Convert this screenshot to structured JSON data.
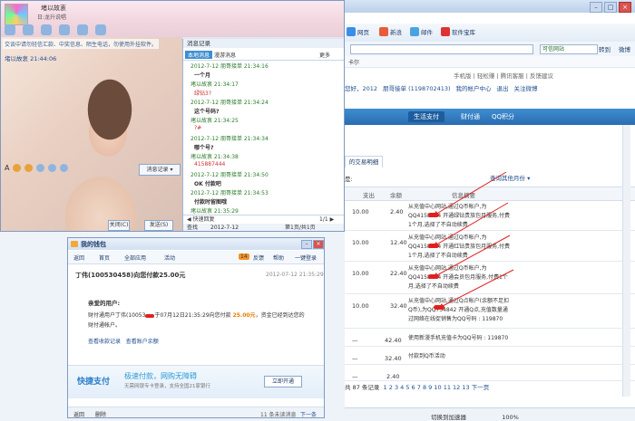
{
  "browser": {
    "toolbar": {
      "web": "网页",
      "social": "新浪",
      "mail": "邮件",
      "software": "软件宝库"
    },
    "address": {
      "safe_site": "可信网站",
      "go": "转到",
      "extra": "微博"
    },
    "bookmark_bar": "卡尔",
    "top_links": "手机版 | 轻松赚 | 腾讯客服 | 反馈建议",
    "user_line": {
      "prefix": "您好，2012",
      "account": "朋哥接单 (1198702413)",
      "my_center": "我的帐户中心",
      "logout": "退出",
      "follow": "关注微博"
    },
    "tabs": [
      "生活支付",
      "财付通",
      "QQ积分"
    ],
    "trade_tab": "的交易明细",
    "range_label": "是:",
    "query_other": "查询其他月份 ▾",
    "table_headers": {
      "out": "支出",
      "balance": "余额",
      "info": "信息摘要"
    },
    "rows": [
      {
        "out": "10.00",
        "balance": "2.40",
        "desc": "从充值中心网站,通过Q币帐户,为QQ4158874 开通绿钻贵族包月服务,付费1个月,选择了不自动续费"
      },
      {
        "out": "10.00",
        "balance": "12.40",
        "desc": "从充值中心网站,通过Q币帐户,为QQ4158874 开通红钻贵族包月服务,付费1个月,选择了不自动续费"
      },
      {
        "out": "10.00",
        "balance": "22.40",
        "desc": "从充值中心网站,通过Q币帐户,为QQ4158874 开通会员包月服务,付费1个月,选择了不自动续费"
      },
      {
        "out": "10.00",
        "balance": "32.40",
        "desc": "从充值中心网站,通过Q点帐户(余额不足扣Q币),为QQ734842 开通Q点,充值数量通过网络在线促销售为QQ号码 : 119870"
      }
    ],
    "extra_rows": [
      {
        "dash": "—",
        "balance": "42.40",
        "text": "使用新漫手机充值卡为QQ号码 : 119870"
      },
      {
        "dash": "—",
        "balance": "32.40",
        "text": "付款到Q币活动"
      },
      {
        "dash": "—",
        "balance": "2.40",
        "text": ""
      }
    ],
    "pager": {
      "total": "共 87 条记录",
      "pages": "1 2 3 4 5 6 7 8 9 10 11 12 13",
      "next": "下一页"
    },
    "status": {
      "speed": "切换到加速器",
      "zoom": "100%"
    }
  },
  "qq": {
    "name": "堵以故衷",
    "status": "日:龙升说唱",
    "warning": "交谈中请勿轻信汇款、中奖信息、陌生电话，勿使用外挂软件。",
    "chat_name": "堵以故衷   21:44:06",
    "msg_record_btn": "消息记录 ▾",
    "close_btn": "关闭(C)",
    "send_btn": "发送(S)",
    "history": {
      "title": "消息记录",
      "tab1": "本地消息",
      "tab2": "漫游消息",
      "more": "更多",
      "lines": [
        {
          "meta": "2012-7-12  朋哥接单 21:34:16",
          "msg": ""
        },
        {
          "meta": "",
          "msg": "一个月"
        },
        {
          "meta": "堵以故衷  21:34:17",
          "msg": ""
        },
        {
          "meta": "",
          "msg": "绿钻3?",
          "red": true
        },
        {
          "meta": "2012-7-12  朋哥接单 21:34:24",
          "msg": ""
        },
        {
          "meta": "",
          "msg": "这个号码?"
        },
        {
          "meta": "堵以故衷  21:34:25",
          "msg": ""
        },
        {
          "meta": "",
          "msg": "?#",
          "red": true
        },
        {
          "meta": "2012-7-12  朋哥接单 21:34:34",
          "msg": ""
        },
        {
          "meta": "",
          "msg": "哪个号?"
        },
        {
          "meta": "堵以故衷  21:34:38",
          "msg": ""
        },
        {
          "meta": "",
          "msg": "415887444",
          "red": true
        },
        {
          "meta": "2012-7-12  朋哥接单 21:34:50",
          "msg": ""
        },
        {
          "meta": "",
          "msg": "OK 付款吧"
        },
        {
          "meta": "2012-7-12  朋哥接单 21:34:53",
          "msg": ""
        },
        {
          "meta": "",
          "msg": "付款时留图哦"
        },
        {
          "meta": "堵以故衷  21:35:29",
          "msg": ""
        }
      ],
      "footer_left": "◀ 快速回复",
      "footer_right": "1/1 ▶",
      "search": "查找",
      "date": "2012-7-12",
      "page": "第1页/共1页"
    }
  },
  "wallet": {
    "title": "我的钱包",
    "toolbar": [
      "返回",
      "首页",
      "全部应用",
      "活动",
      "14",
      "反馈",
      "帮助",
      "一键登录"
    ],
    "subject": "丁伟(100530458)向您付款25.00元",
    "time": "2012-07-12 21:35:29",
    "greet": "亲爱的用户:",
    "body_prefix": "财付通用户丁伟(10053",
    "body_mid": "于07月12日21:35:29向您付款",
    "amount": "25.00元",
    "body_suffix": "，资金已经到达您的财付通帐户。",
    "link1": "查看收款记录",
    "link2": "查看账户余额",
    "banner_logo": "快捷支付",
    "banner_slogan": "极速付款，网购无障碍",
    "banner_sub": "无需网银专卡登录，支持全国21家银行",
    "banner_btn": "立即开通",
    "footer_left": "返回",
    "footer_del": "删除",
    "footer_count": "11 条未读消息",
    "footer_next": "下一条"
  }
}
